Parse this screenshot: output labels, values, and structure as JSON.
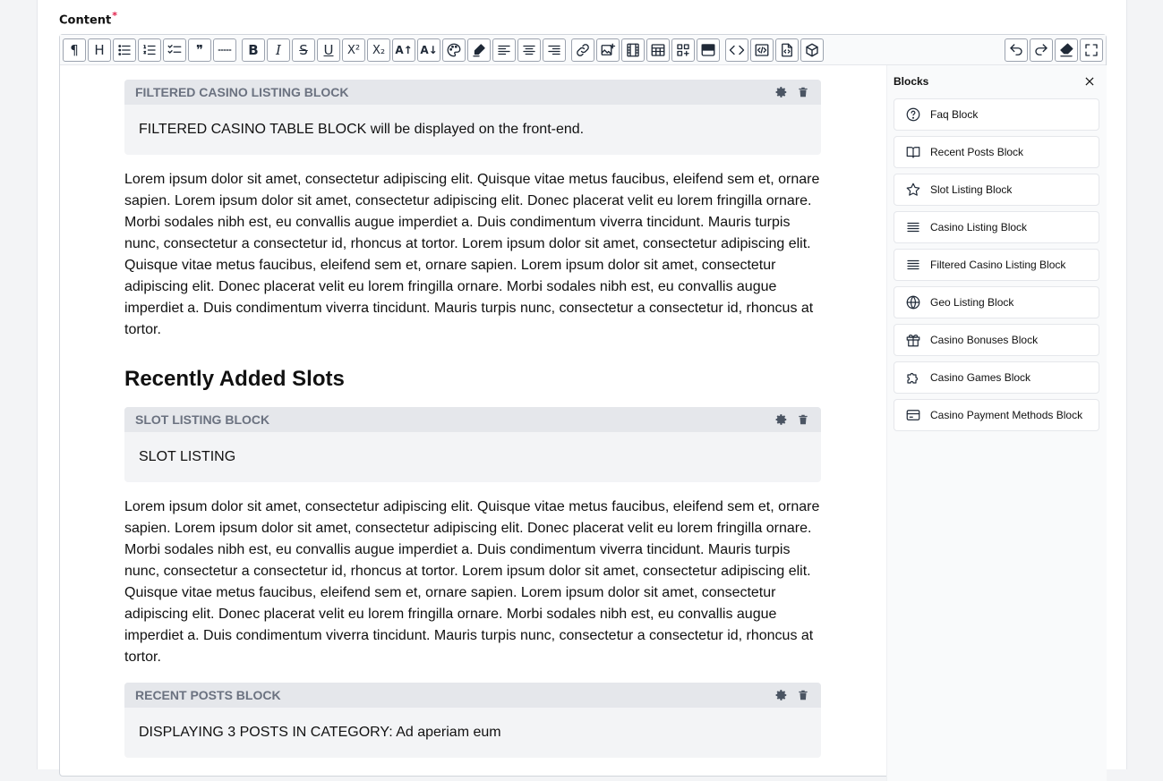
{
  "field": {
    "label": "Content",
    "required_mark": "*"
  },
  "toolbar": {
    "buttons": [
      {
        "name": "paragraph-icon",
        "glyph": "¶"
      },
      {
        "name": "heading-icon",
        "glyph": "H"
      },
      {
        "name": "bullet-list-icon"
      },
      {
        "name": "numbered-list-icon"
      },
      {
        "name": "checklist-icon"
      },
      {
        "name": "quote-icon",
        "glyph": "❞"
      },
      {
        "name": "horizontal-rule-icon"
      },
      {
        "name": "bold-icon",
        "glyph": "B"
      },
      {
        "name": "italic-icon",
        "glyph": "I"
      },
      {
        "name": "strikethrough-icon",
        "glyph": "S"
      },
      {
        "name": "underline-icon",
        "glyph": "U"
      },
      {
        "name": "superscript-icon",
        "glyph": "X²"
      },
      {
        "name": "subscript-icon",
        "glyph": "X₂"
      },
      {
        "name": "font-size-up-icon",
        "glyph": "A↑"
      },
      {
        "name": "font-size-down-icon",
        "glyph": "A↓"
      },
      {
        "name": "palette-icon"
      },
      {
        "name": "highlighter-icon"
      },
      {
        "name": "align-left-icon"
      },
      {
        "name": "align-center-icon"
      },
      {
        "name": "align-right-icon"
      },
      {
        "name": "link-icon"
      },
      {
        "name": "image-add-icon"
      },
      {
        "name": "video-icon"
      },
      {
        "name": "table-icon"
      },
      {
        "name": "blocks-icon"
      },
      {
        "name": "block-bar-icon"
      },
      {
        "name": "code-icon"
      },
      {
        "name": "code-block-icon"
      },
      {
        "name": "embed-icon"
      },
      {
        "name": "cube-icon"
      },
      {
        "name": "undo-icon"
      },
      {
        "name": "redo-icon"
      },
      {
        "name": "clear-format-icon"
      },
      {
        "name": "fullscreen-icon"
      }
    ]
  },
  "content": {
    "block1": {
      "title": "FILTERED CASINO LISTING BLOCK",
      "body": "FILTERED CASINO TABLE BLOCK will be displayed on the front-end."
    },
    "para1": "Lorem ipsum dolor sit amet, consectetur adipiscing elit. Quisque vitae metus faucibus, eleifend sem et, ornare sapien. Lorem ipsum dolor sit amet, consectetur adipiscing elit. Donec placerat velit eu lorem fringilla ornare. Morbi sodales nibh est, eu convallis augue imperdiet a. Duis condimentum viverra tincidunt. Mauris turpis nunc, consectetur a consectetur id, rhoncus at tortor. Lorem ipsum dolor sit amet, consectetur adipiscing elit. Quisque vitae metus faucibus, eleifend sem et, ornare sapien. Lorem ipsum dolor sit amet, consectetur adipiscing elit. Donec placerat velit eu lorem fringilla ornare. Morbi sodales nibh est, eu convallis augue imperdiet a. Duis condimentum viverra tincidunt. Mauris turpis nunc, consectetur a consectetur id, rhoncus at tortor.",
    "heading": "Recently Added Slots",
    "block2": {
      "title": "SLOT LISTING BLOCK",
      "body": "SLOT LISTING"
    },
    "para2": "Lorem ipsum dolor sit amet, consectetur adipiscing elit. Quisque vitae metus faucibus, eleifend sem et, ornare sapien. Lorem ipsum dolor sit amet, consectetur adipiscing elit. Donec placerat velit eu lorem fringilla ornare. Morbi sodales nibh est, eu convallis augue imperdiet a. Duis condimentum viverra tincidunt. Mauris turpis nunc, consectetur a consectetur id, rhoncus at tortor. Lorem ipsum dolor sit amet, consectetur adipiscing elit. Quisque vitae metus faucibus, eleifend sem et, ornare sapien. Lorem ipsum dolor sit amet, consectetur adipiscing elit. Donec placerat velit eu lorem fringilla ornare. Morbi sodales nibh est, eu convallis augue imperdiet a. Duis condimentum viverra tincidunt. Mauris turpis nunc, consectetur a consectetur id, rhoncus at tortor.",
    "block3": {
      "title": "RECENT POSTS BLOCK",
      "body": "DISPLAYING 3 POSTS IN CATEGORY: Ad aperiam eum"
    }
  },
  "panel": {
    "title": "Blocks",
    "items": [
      {
        "label": "Faq Block",
        "icon": "question-circle-icon"
      },
      {
        "label": "Recent Posts Block",
        "icon": "book-icon"
      },
      {
        "label": "Slot Listing Block",
        "icon": "star-icon"
      },
      {
        "label": "Casino Listing Block",
        "icon": "lines-icon"
      },
      {
        "label": "Filtered Casino Listing Block",
        "icon": "lines-icon"
      },
      {
        "label": "Geo Listing Block",
        "icon": "globe-icon"
      },
      {
        "label": "Casino Bonuses Block",
        "icon": "gift-icon"
      },
      {
        "label": "Casino Games Block",
        "icon": "puzzle-icon"
      },
      {
        "label": "Casino Payment Methods Block",
        "icon": "credit-card-icon"
      }
    ]
  }
}
